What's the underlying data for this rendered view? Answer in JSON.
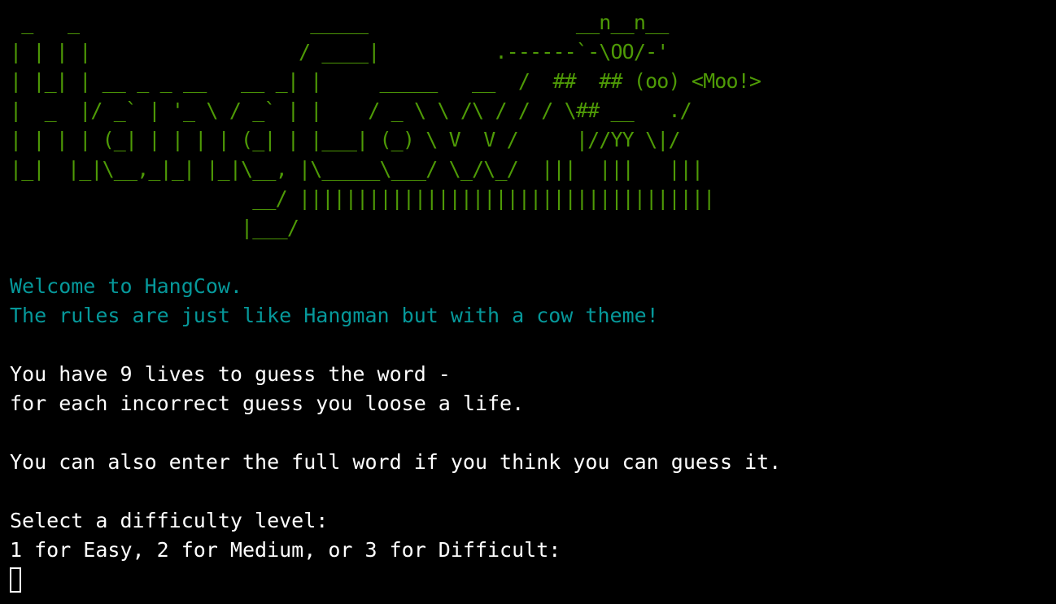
{
  "banner": {
    "ascii_art": " _   _                    _____                  __n__n__\n| | | |                  / ____|          .------`-\\OO/-'\n| |_| | __ _ _ __   __ _| |     _____   __  /  ##  ## (oo) <Moo!>\n|  _  |/ _` | '_ \\ / _` | |    / _ \\ \\ /\\ / / / \\## __   ./\n| | | | (_| | | | | (_| | |___| (_) \\ V  V /     |//YY \\|/\n|_|  |_|\\__,_|_| |_|\\__, |\\_____\\___/ \\_/\\_/  |||  |||   |||\n                     __/ ||||||||||||||||||||||||||||||||||||\n                    |___/"
  },
  "intro": {
    "welcome": "Welcome to HangCow.",
    "rules": "The rules are just like Hangman but with a cow theme!"
  },
  "instructions": {
    "lives_line1": "You have 9 lives to guess the word -",
    "lives_line2": "for each incorrect guess you loose a life.",
    "full_word": "You can also enter the full word if you think you can guess it."
  },
  "difficulty": {
    "prompt": "Select a difficulty level:",
    "options": "1 for Easy, 2 for Medium, or 3 for Difficult:"
  },
  "input": {
    "value": ""
  },
  "colors": {
    "background": "#000000",
    "banner": "#4e9a06",
    "welcome": "#06989a",
    "text": "#ffffff"
  }
}
